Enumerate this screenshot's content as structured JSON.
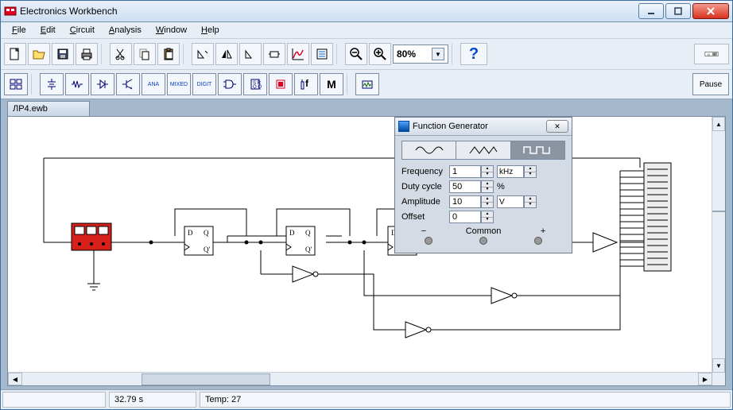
{
  "title": "Electronics Workbench",
  "menus": [
    "File",
    "Edit",
    "Circuit",
    "Analysis",
    "Window",
    "Help"
  ],
  "zoom": "80%",
  "pause": "Pause",
  "doc_name": "ЛР4.ewb",
  "status": {
    "time": "32.79 s",
    "temp": "Temp:  27"
  },
  "func_gen": {
    "title": "Function Generator",
    "frequency_label": "Frequency",
    "frequency_value": "1",
    "frequency_unit": "kHz",
    "duty_label": "Duty cycle",
    "duty_value": "50",
    "duty_unit": "%",
    "amplitude_label": "Amplitude",
    "amplitude_value": "10",
    "amplitude_unit": "V",
    "offset_label": "Offset",
    "offset_value": "0",
    "minus": "−",
    "common": "Common",
    "plus": "+"
  },
  "components": {
    "ff": [
      "D",
      "Q",
      "Q'"
    ]
  },
  "comp_btn_labels": [
    "ANA",
    "MIXED",
    "DIGIT",
    "M"
  ]
}
